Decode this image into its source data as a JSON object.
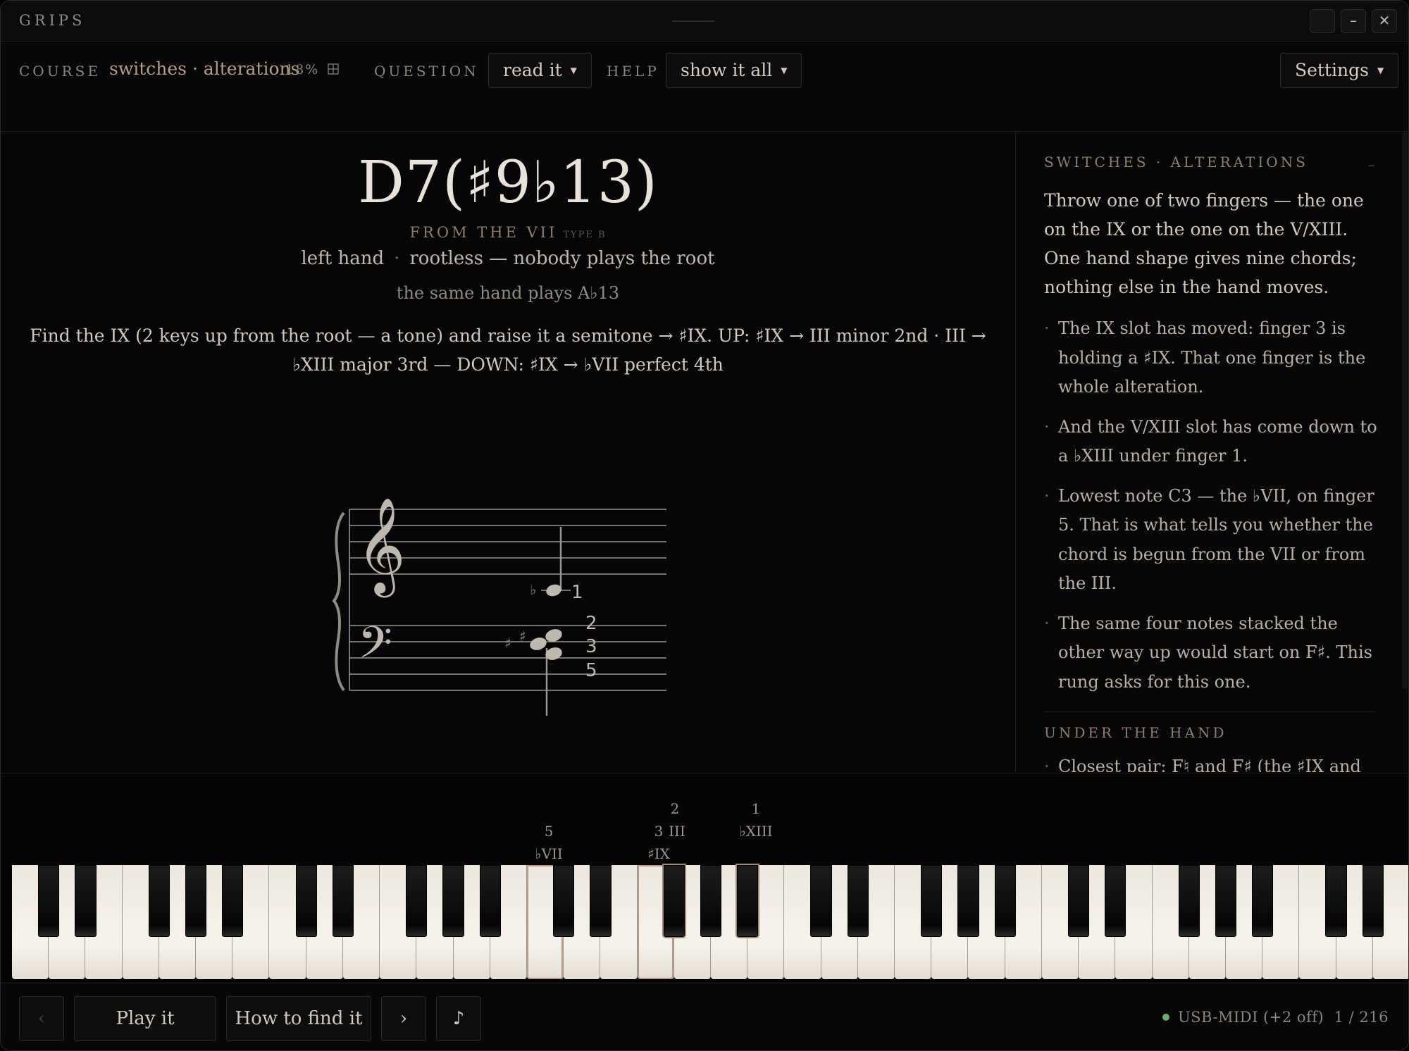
{
  "app": {
    "title": "GRIPS"
  },
  "window_controls": {
    "minimize": "–",
    "close": "✕"
  },
  "toolbar": {
    "course_label": "COURSE",
    "course_name": "switches · alterations",
    "course_progress": "18%",
    "question_label": "QUESTION",
    "question_value": "read it",
    "help_label": "HELP",
    "help_value": "show it all",
    "settings_label": "Settings"
  },
  "chord": {
    "name": "D7(♯9♭13)",
    "from": "FROM THE VII",
    "type": "TYPE B",
    "hand": "left hand",
    "voicing": "rootless — nobody plays the root",
    "same_hand": "the same hand plays A♭13",
    "instruction": "Find the IX (2 keys up from the root — a tone) and raise it a semitone → ♯IX. UP: ♯IX → III minor 2nd · III → ♭XIII major 3rd — DOWN: ♯IX → ♭VII perfect 4th"
  },
  "notation": {
    "treble_fingering": "1",
    "bass_fingering": [
      "2",
      "3",
      "5"
    ],
    "treble_accidental": "♭",
    "bass_accidentals": [
      "♯",
      "♯"
    ]
  },
  "sidebar": {
    "heading": "SWITCHES · ALTERATIONS",
    "collapse": "–",
    "intro": "Throw one of two fingers — the one on the IX or the one on the V/XIII. One hand shape gives nine chords; nothing else in the hand moves.",
    "bullets": [
      "The IX slot has moved: finger 3 is holding a ♯IX. That one finger is the whole alteration.",
      "And the V/XIII slot has come down to a ♭XIII under finger 1.",
      "Lowest note C3 — the ♭VII, on finger 5. That is what tells you whether the chord is begun from the VII or from the III.",
      "The same four notes stacked the other way up would start on F♯. This rung asks for this one."
    ],
    "under_heading": "UNDER THE HAND",
    "under_bullets": [
      "Closest pair: F♮ and F♯ (the ♯IX and the"
    ]
  },
  "keyboard": {
    "labels": [
      {
        "finger": "5",
        "degree": "♭VII"
      },
      {
        "finger": "3",
        "degree": "♯IX",
        "second": "III"
      },
      {
        "finger": "2",
        "degree": ""
      },
      {
        "finger": "1",
        "degree": "♭XIII"
      }
    ],
    "white_key_count": 38,
    "highlighted_white": [
      14,
      17
    ],
    "highlighted_black": [
      17,
      19
    ]
  },
  "bottom": {
    "prev": "‹",
    "play": "Play it",
    "how": "How to find it",
    "next": "›",
    "note_icon": "♪",
    "midi_status": "USB-MIDI (+2 off)",
    "position": "1 / 216"
  }
}
